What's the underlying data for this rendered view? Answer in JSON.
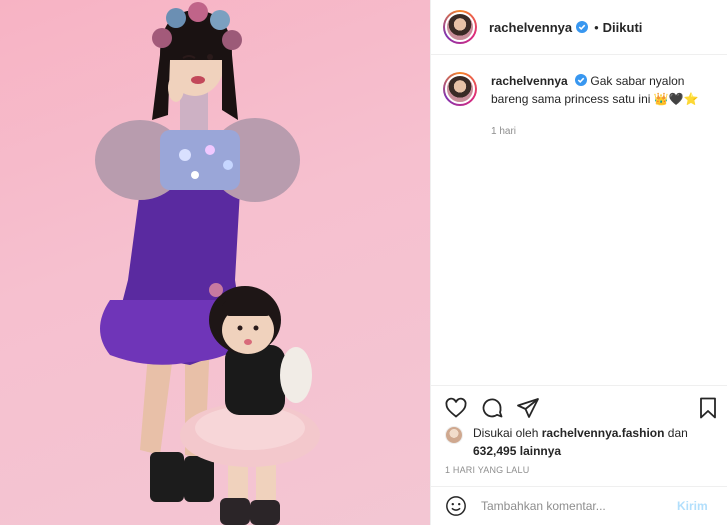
{
  "post": {
    "username": "rachelvennya",
    "separator": "•",
    "follow_status": "Diikuti",
    "caption_text": "Gak sabar nyalon bareng sama princess satu ini 👑🖤⭐",
    "time_relative": "1 hari",
    "liked_by_prefix": "Disukai oleh",
    "liked_by_user": "rachelvennya.fashion",
    "liked_by_and": "dan",
    "likes_count": "632,495",
    "likes_suffix": "lainnya",
    "posted_ago": "1 HARI YANG LALU"
  },
  "comment": {
    "placeholder": "Tambahkan komentar...",
    "post_label": "Kirim"
  },
  "icons": {
    "like": "heart-icon",
    "comment": "comment-icon",
    "share": "share-icon",
    "save": "bookmark-icon",
    "emoji": "emoji-icon",
    "verified": "verified-badge-icon"
  },
  "colors": {
    "accent_link": "#0095f6",
    "verified": "#3897f0",
    "muted": "#8e8e8e",
    "text": "#262626",
    "photo_bg": "#f6bdcc"
  }
}
